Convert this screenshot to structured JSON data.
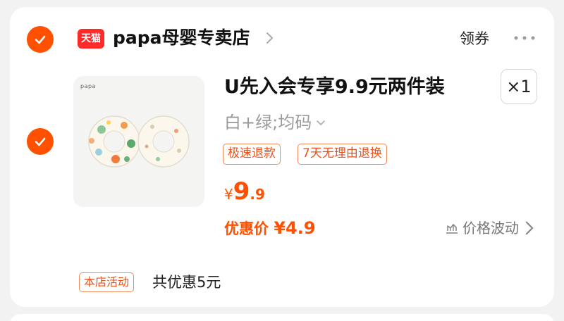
{
  "store": {
    "badge": "天猫",
    "name": "papa母婴专卖店",
    "coupon_label": "领券",
    "more_icon": "more-dots-icon"
  },
  "product": {
    "brand_mark": "papa",
    "title": "U先入会专享9.9元两件装",
    "quantity": "×1",
    "sku": "白+绿;均码",
    "tags": [
      "极速退款",
      "7天无理由退换"
    ],
    "price": {
      "symbol": "¥",
      "integer": "9",
      "decimal": ".9"
    },
    "discount": {
      "label": "优惠价",
      "amount": "¥4.9"
    },
    "price_fluctuation": "价格波动"
  },
  "promotion": {
    "tag": "本店活动",
    "text": "共优惠5元"
  },
  "colors": {
    "accent": "#ff5000",
    "tmall_red": "#ff2a2a",
    "tag_border": "#f08a5a"
  }
}
